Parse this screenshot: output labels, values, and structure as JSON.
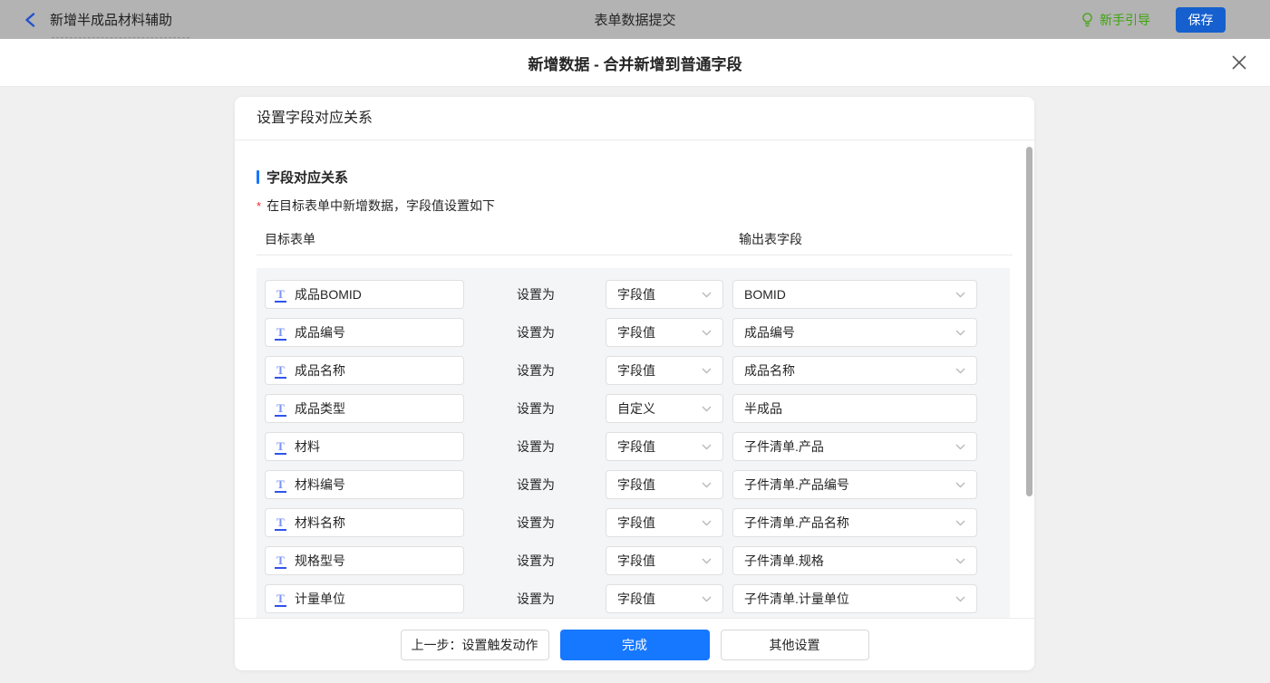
{
  "topbar": {
    "back_label": "新增半成品材料辅助",
    "center_title": "表单数据提交",
    "guide_label": "新手引导",
    "save_label": "保存"
  },
  "modal": {
    "title": "新增数据 - 合并新增到普通字段"
  },
  "card": {
    "header": "设置字段对应关系",
    "section_title": "字段对应关系",
    "required_mark": "*",
    "section_desc": "在目标表单中新增数据，字段值设置如下",
    "col_left": "目标表单",
    "col_right": "输出表字段",
    "set_as_label": "设置为",
    "rows": [
      {
        "field": "成品BOMID",
        "mode": "字段值",
        "value": "BOMID",
        "value_type": "select"
      },
      {
        "field": "成品编号",
        "mode": "字段值",
        "value": "成品编号",
        "value_type": "select"
      },
      {
        "field": "成品名称",
        "mode": "字段值",
        "value": "成品名称",
        "value_type": "select"
      },
      {
        "field": "成品类型",
        "mode": "自定义",
        "value": "半成品",
        "value_type": "input"
      },
      {
        "field": "材料",
        "mode": "字段值",
        "value": "子件清单.产品",
        "value_type": "select"
      },
      {
        "field": "材料编号",
        "mode": "字段值",
        "value": "子件清单.产品编号",
        "value_type": "select"
      },
      {
        "field": "材料名称",
        "mode": "字段值",
        "value": "子件清单.产品名称",
        "value_type": "select"
      },
      {
        "field": "规格型号",
        "mode": "字段值",
        "value": "子件清单.规格",
        "value_type": "select"
      },
      {
        "field": "计量单位",
        "mode": "字段值",
        "value": "子件清单.计量单位",
        "value_type": "select"
      },
      {
        "field": "",
        "mode": "",
        "value": "",
        "value_type": "select"
      }
    ],
    "footer": {
      "prev_label": "上一步：设置触发动作",
      "done_label": "完成",
      "other_label": "其他设置"
    }
  },
  "colors": {
    "primary_blue": "#1677ff",
    "save_blue": "#1560ce",
    "guide_green": "#3da50c",
    "required_red": "#f5222d",
    "topbar_gray": "#b3b3b3"
  }
}
